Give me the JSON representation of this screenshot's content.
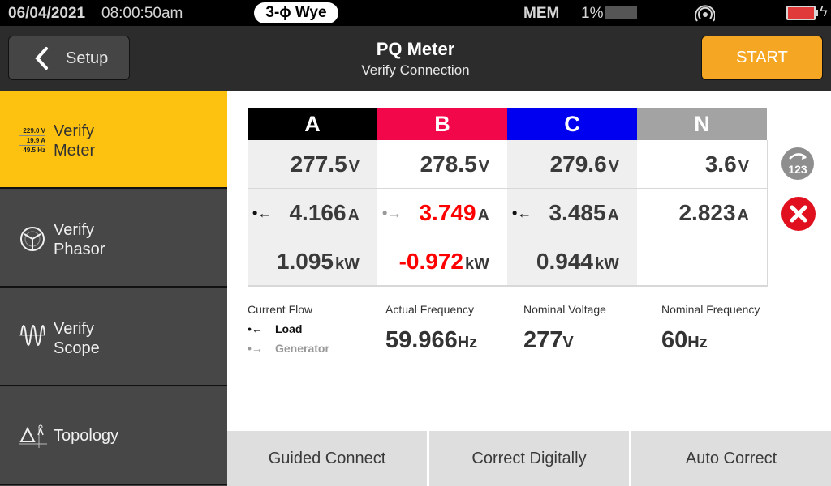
{
  "status_bar": {
    "date": "06/04/2021",
    "time": "08:00:50am",
    "configuration": "3-ϕ Wye",
    "memory_label": "MEM",
    "memory_percent": "1%",
    "memory_used_fraction": 0.01,
    "signal_icon": "wireless-signal-icon",
    "battery_icon": "battery-charging-icon",
    "battery_color": "#e03a3a"
  },
  "header": {
    "back_label": "Setup",
    "title": "PQ Meter",
    "subtitle": "Verify Connection",
    "start_label": "START",
    "start_color": "#f5a623"
  },
  "sidebar": {
    "items": [
      {
        "label_line1": "Verify",
        "label_line2": "Meter",
        "icon": "meter-readout-icon",
        "active": true,
        "icon_values": [
          "229.0 V",
          "19.9 A",
          "49.5 Hz"
        ]
      },
      {
        "label_line1": "Verify",
        "label_line2": "Phasor",
        "icon": "phasor-icon",
        "active": false
      },
      {
        "label_line1": "Verify",
        "label_line2": "Scope",
        "icon": "scope-wave-icon",
        "active": false
      },
      {
        "label_line1": "Topology",
        "label_line2": "",
        "icon": "topology-icon",
        "active": false
      }
    ],
    "active_color": "#fdc20f"
  },
  "grid": {
    "phases": [
      {
        "name": "A",
        "color": "#000000"
      },
      {
        "name": "B",
        "color": "#f2074a"
      },
      {
        "name": "C",
        "color": "#0000f0"
      },
      {
        "name": "N",
        "color": "#a3a3a3"
      }
    ],
    "voltage": [
      {
        "value": "277.5",
        "unit": "V"
      },
      {
        "value": "278.5",
        "unit": "V"
      },
      {
        "value": "279.6",
        "unit": "V"
      },
      {
        "value": "3.6",
        "unit": "V"
      }
    ],
    "current": [
      {
        "value": "4.166",
        "unit": "A",
        "flow": "load"
      },
      {
        "value": "3.749",
        "unit": "A",
        "flow": "generator",
        "alert": true
      },
      {
        "value": "3.485",
        "unit": "A",
        "flow": "load"
      },
      {
        "value": "2.823",
        "unit": "A",
        "flow": ""
      }
    ],
    "power": [
      {
        "value": "1.095",
        "unit": "kW"
      },
      {
        "value": "-0.972",
        "unit": "kW",
        "alert": true
      },
      {
        "value": "0.944",
        "unit": "kW"
      },
      {
        "value": "",
        "unit": ""
      }
    ],
    "rotation_icon_text": "123"
  },
  "info": {
    "current_flow_label": "Current Flow",
    "load_label": "Load",
    "generator_label": "Generator",
    "actual_frequency_label": "Actual Frequency",
    "actual_frequency_value": "59.966",
    "actual_frequency_unit": "Hz",
    "nominal_voltage_label": "Nominal Voltage",
    "nominal_voltage_value": "277",
    "nominal_voltage_unit": "V",
    "nominal_frequency_label": "Nominal Frequency",
    "nominal_frequency_value": "60",
    "nominal_frequency_unit": "Hz"
  },
  "bottom_buttons": {
    "guided_connect": "Guided Connect",
    "correct_digitally": "Correct Digitally",
    "auto_correct": "Auto Correct"
  }
}
